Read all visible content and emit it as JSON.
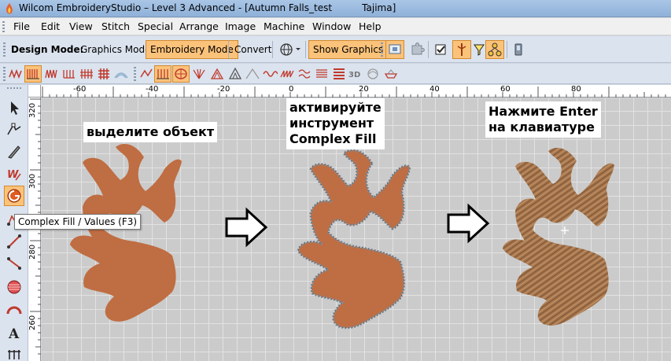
{
  "window": {
    "title": "Wilcom EmbroideryStudio – Level 3 Advanced - [Autumn Falls_test          Tajima]"
  },
  "menu": [
    "File",
    "Edit",
    "View",
    "Stitch",
    "Special",
    "Arrange",
    "Image",
    "Machine",
    "Window",
    "Help"
  ],
  "design_toolbar": {
    "label": "Design Mode:",
    "graphics_mode": "Graphics Mode",
    "embroidery_mode": "Embroidery Mode",
    "convert": "Convert",
    "show_graphics": "Show Graphics"
  },
  "ruler": {
    "top": [
      "-60",
      "-40",
      "-20",
      "0",
      "20",
      "40",
      "60",
      "80"
    ],
    "left": [
      "320",
      "300",
      "280",
      "260"
    ]
  },
  "tooltip": "Complex Fill / Values (F3)",
  "callouts": {
    "step1": "выделите объект",
    "step2_line1": "активируйте",
    "step2_line2": "инструмент",
    "step2_line3": "Complex Fill",
    "step3_line1": "Нажмите Enter",
    "step3_line2": "на клавиатуре"
  },
  "colors": {
    "leaf_fill": "#bf6d42",
    "leaf_stitched": "#a4754c",
    "outline": "#7b8fa0",
    "active_tool": "#fbc27a"
  }
}
